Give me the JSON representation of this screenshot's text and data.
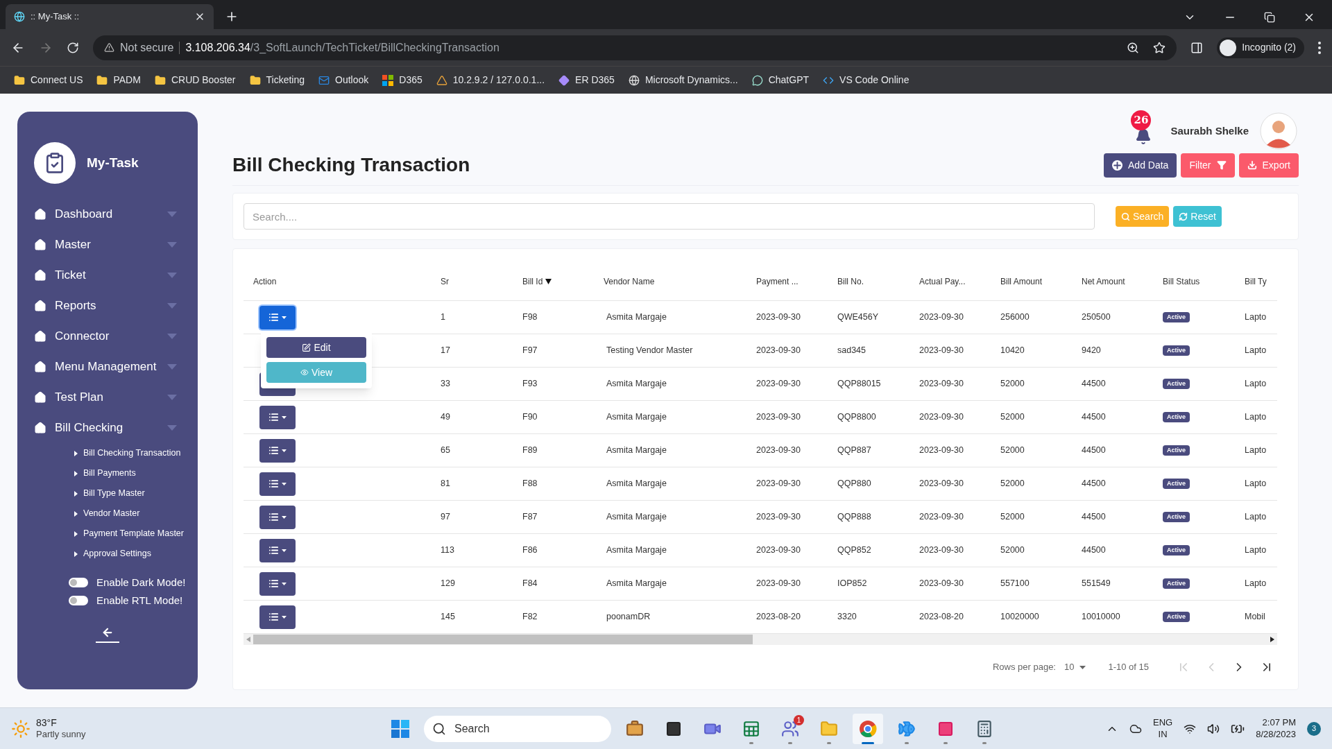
{
  "browser": {
    "tab_title": ":: My-Task ::",
    "security": "Not secure",
    "url_host": "3.108.206.34",
    "url_path": "/3_SoftLaunch/TechTicket/BillCheckingTransaction",
    "profile": "Incognito (2)",
    "bookmarks": [
      {
        "kind": "folder",
        "label": "Connect US"
      },
      {
        "kind": "folder",
        "label": "PADM"
      },
      {
        "kind": "folder",
        "label": "CRUD Booster"
      },
      {
        "kind": "folder",
        "label": "Ticketing"
      },
      {
        "kind": "mail",
        "label": "Outlook"
      },
      {
        "kind": "grid",
        "label": "D365"
      },
      {
        "kind": "cone",
        "label": "10.2.9.2 / 127.0.0.1..."
      },
      {
        "kind": "diamond",
        "label": "ER D365"
      },
      {
        "kind": "globe",
        "label": "Microsoft Dynamics..."
      },
      {
        "kind": "chat",
        "label": "ChatGPT"
      },
      {
        "kind": "code",
        "label": "VS Code Online"
      }
    ]
  },
  "sidebar": {
    "app_name": "My-Task",
    "items": [
      {
        "label": "Dashboard"
      },
      {
        "label": "Master"
      },
      {
        "label": "Ticket"
      },
      {
        "label": "Reports"
      },
      {
        "label": "Connector"
      },
      {
        "label": "Menu Management"
      },
      {
        "label": "Test Plan"
      },
      {
        "label": "Bill Checking",
        "children": [
          {
            "label": "Bill Checking Transaction"
          },
          {
            "label": "Bill Payments"
          },
          {
            "label": "Bill Type Master"
          },
          {
            "label": "Vendor Master"
          },
          {
            "label": "Payment Template Master"
          },
          {
            "label": "Approval Settings"
          }
        ]
      }
    ],
    "toggles": [
      {
        "label": "Enable Dark Mode!",
        "on": false
      },
      {
        "label": "Enable RTL Mode!",
        "on": false
      }
    ]
  },
  "header": {
    "notifications": "26",
    "user_name": "Saurabh Shelke"
  },
  "page": {
    "title": "Bill Checking Transaction",
    "actions": [
      {
        "kind": "add",
        "label": "Add Data"
      },
      {
        "kind": "filter",
        "label": "Filter"
      },
      {
        "kind": "export",
        "label": "Export"
      }
    ]
  },
  "search": {
    "placeholder": "Search....",
    "search_button": "Search",
    "reset_button": "Reset"
  },
  "table": {
    "columns": [
      {
        "label": "Action",
        "sorted": false
      },
      {
        "label": "Sr",
        "sorted": false
      },
      {
        "label": "Bill Id",
        "sorted": true
      },
      {
        "label": "Vendor Name",
        "sorted": false
      },
      {
        "label": "Payment ...",
        "sorted": false
      },
      {
        "label": "Bill No.",
        "sorted": false
      },
      {
        "label": "Actual Pay...",
        "sorted": false
      },
      {
        "label": "Bill Amount",
        "sorted": false
      },
      {
        "label": "Net Amount",
        "sorted": false
      },
      {
        "label": "Bill Status",
        "sorted": false
      },
      {
        "label": "Bill Ty",
        "sorted": false
      }
    ],
    "action_menu": [
      "Edit",
      "View"
    ],
    "rows": [
      {
        "cells": [
          "",
          "1",
          "F98",
          "Asmita Margaje",
          "2023-09-30",
          "QWE456Y",
          "2023-09-30",
          "256000",
          "250500",
          "Active",
          "Lapto"
        ],
        "menu_open": true,
        "action_button": true
      },
      {
        "cells": [
          "",
          "17",
          "F97",
          "Testing Vendor Master",
          "2023-09-30",
          "sad345",
          "2023-09-30",
          "10420",
          "9420",
          "Active",
          "Lapto"
        ],
        "menu_open": false,
        "action_button": false
      },
      {
        "cells": [
          "",
          "33",
          "F93",
          "Asmita Margaje",
          "2023-09-30",
          "QQP88015",
          "2023-09-30",
          "52000",
          "44500",
          "Active",
          "Lapto"
        ],
        "menu_open": false,
        "action_button": true
      },
      {
        "cells": [
          "",
          "49",
          "F90",
          "Asmita Margaje",
          "2023-09-30",
          "QQP8800",
          "2023-09-30",
          "52000",
          "44500",
          "Active",
          "Lapto"
        ],
        "menu_open": false,
        "action_button": true
      },
      {
        "cells": [
          "",
          "65",
          "F89",
          "Asmita Margaje",
          "2023-09-30",
          "QQP887",
          "2023-09-30",
          "52000",
          "44500",
          "Active",
          "Lapto"
        ],
        "menu_open": false,
        "action_button": true
      },
      {
        "cells": [
          "",
          "81",
          "F88",
          "Asmita Margaje",
          "2023-09-30",
          "QQP880",
          "2023-09-30",
          "52000",
          "44500",
          "Active",
          "Lapto"
        ],
        "menu_open": false,
        "action_button": true
      },
      {
        "cells": [
          "",
          "97",
          "F87",
          "Asmita Margaje",
          "2023-09-30",
          "QQP888",
          "2023-09-30",
          "52000",
          "44500",
          "Active",
          "Lapto"
        ],
        "menu_open": false,
        "action_button": true
      },
      {
        "cells": [
          "",
          "113",
          "F86",
          "Asmita Margaje",
          "2023-09-30",
          "QQP852",
          "2023-09-30",
          "52000",
          "44500",
          "Active",
          "Lapto"
        ],
        "menu_open": false,
        "action_button": true
      },
      {
        "cells": [
          "",
          "129",
          "F84",
          "Asmita Margaje",
          "2023-09-30",
          "IOP852",
          "2023-09-30",
          "557100",
          "551549",
          "Active",
          "Lapto"
        ],
        "menu_open": false,
        "action_button": true
      },
      {
        "cells": [
          "",
          "145",
          "F82",
          "poonamDR",
          "2023-08-20",
          "3320",
          "2023-08-20",
          "10020000",
          "10010000",
          "Active",
          "Mobil"
        ],
        "menu_open": false,
        "action_button": true
      }
    ],
    "pagination": {
      "rows_per_page_label": "Rows per page:",
      "rows_per_page": "10",
      "range": "1-10 of 15",
      "first_disabled": true,
      "prev_disabled": true,
      "next_disabled": false,
      "last_disabled": false
    }
  },
  "taskbar": {
    "temperature": "83°F",
    "weather": "Partly sunny",
    "search_placeholder": "Search",
    "apps": [
      {
        "kind": "start",
        "running": false,
        "selected": false
      },
      {
        "kind": "briefcase",
        "running": false,
        "selected": false
      },
      {
        "kind": "window",
        "running": false,
        "selected": false
      },
      {
        "kind": "video",
        "running": false,
        "selected": false
      },
      {
        "kind": "sheet",
        "running": true,
        "selected": false
      },
      {
        "kind": "team",
        "running": true,
        "selected": false,
        "badge": "1"
      },
      {
        "kind": "folder",
        "running": true,
        "selected": false
      },
      {
        "kind": "browser",
        "running": true,
        "selected": true
      },
      {
        "kind": "fish",
        "running": true,
        "selected": false
      },
      {
        "kind": "writer",
        "running": true,
        "selected": false
      },
      {
        "kind": "calculator",
        "running": true,
        "selected": false
      }
    ],
    "language": "ENG",
    "region": "IN",
    "time": "2:07 PM",
    "date": "8/28/2023",
    "notifications": "3"
  }
}
